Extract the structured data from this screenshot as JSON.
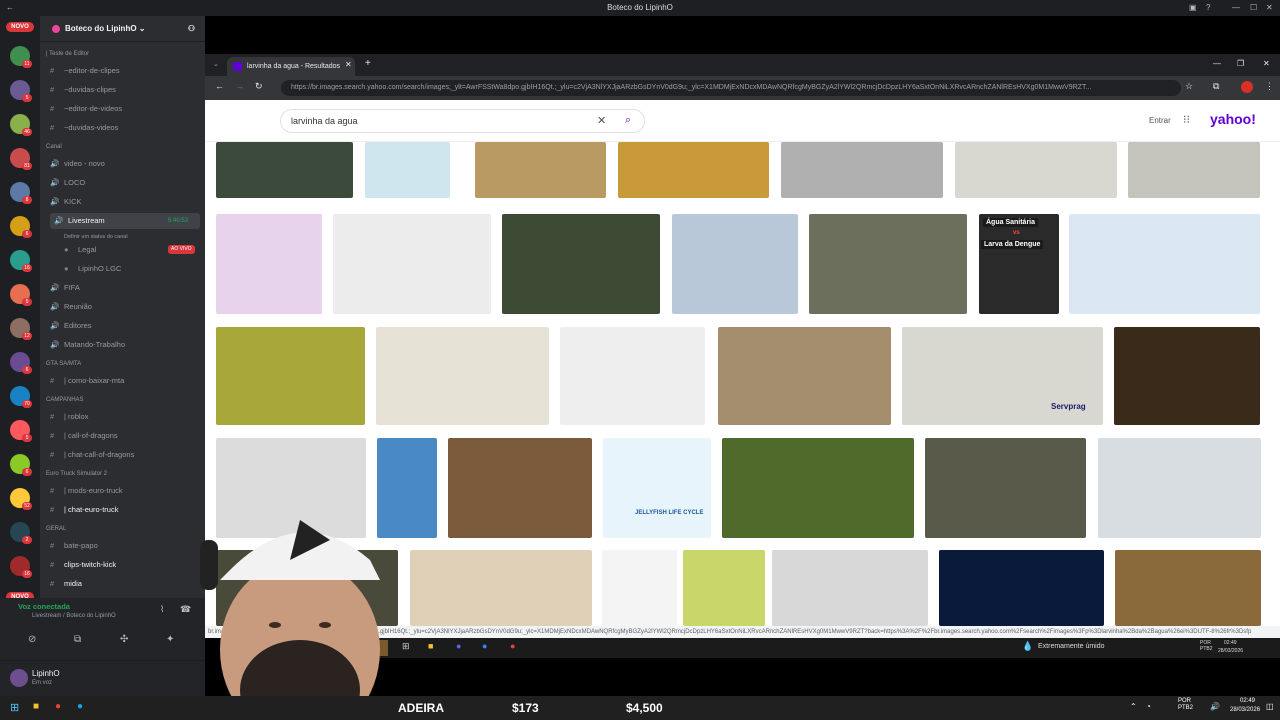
{
  "window": {
    "title": "Boteco do LipinhO"
  },
  "servers": {
    "novo_top": "NOVO",
    "novo_bottom": "NOVO",
    "badges": [
      "11",
      "5",
      "46",
      "81",
      "8",
      "6",
      "16",
      "5",
      "12",
      "6",
      "70",
      "5",
      "6",
      "52",
      "2",
      "16"
    ]
  },
  "guild": {
    "name": "Boteco do LipinhO"
  },
  "channels": [
    {
      "kind": "category",
      "label": "| Teste de Editor"
    },
    {
      "kind": "channel",
      "icon": "#",
      "label": "~editor-de-clipes"
    },
    {
      "kind": "channel",
      "icon": "#",
      "label": "~duvidas-clipes"
    },
    {
      "kind": "channel",
      "icon": "#",
      "label": "~editor-de-videos"
    },
    {
      "kind": "channel",
      "icon": "#",
      "label": "~duvidas-videos"
    },
    {
      "kind": "category",
      "label": "Canal"
    },
    {
      "kind": "voice",
      "label": "video - novo"
    },
    {
      "kind": "voice",
      "label": "LOCO"
    },
    {
      "kind": "voice",
      "label": "KICK"
    },
    {
      "kind": "voice",
      "label": "Livestream",
      "time": "5:40:53",
      "active": true
    },
    {
      "kind": "sub",
      "label": "Definir um status do canal"
    },
    {
      "kind": "member",
      "label": "Legal",
      "tag": "AO VIVO"
    },
    {
      "kind": "member",
      "label": "LipinhO LGC"
    },
    {
      "kind": "voice",
      "label": "FIFA"
    },
    {
      "kind": "voice",
      "label": "Reunião"
    },
    {
      "kind": "voice",
      "label": "Editores"
    },
    {
      "kind": "voice",
      "label": "Matando-Trabalho"
    },
    {
      "kind": "category",
      "label": "GTA SA/MTA"
    },
    {
      "kind": "channel",
      "icon": "#",
      "label": "| como-baixar-mta"
    },
    {
      "kind": "category",
      "label": "CAMPANHAS"
    },
    {
      "kind": "channel",
      "icon": "#",
      "label": "| roblox"
    },
    {
      "kind": "channel",
      "icon": "#",
      "label": "| call-of-dragons"
    },
    {
      "kind": "channel",
      "icon": "#",
      "label": "| chat-call-of-dragons"
    },
    {
      "kind": "category",
      "label": "Euro Truck Simulator 2"
    },
    {
      "kind": "channel",
      "icon": "#",
      "label": "| mods-euro-truck"
    },
    {
      "kind": "channel",
      "icon": "#",
      "label": "| chat-euro-truck",
      "bold": true
    },
    {
      "kind": "category",
      "label": "GERAL"
    },
    {
      "kind": "channel",
      "icon": "#",
      "label": "bate-papo"
    },
    {
      "kind": "channel",
      "icon": "#",
      "label": "clips-twitch-kick",
      "bold": true
    },
    {
      "kind": "channel",
      "icon": "#",
      "label": "midia",
      "bold": true
    }
  ],
  "voice": {
    "status": "Voz conectada",
    "where": "Livestream / Boteco do LipinhO"
  },
  "user": {
    "name": "LipinhO",
    "status": "Em voz"
  },
  "browser": {
    "tab_title": "larvinha da agua - Resultados",
    "url": "https://br.images.search.yahoo.com/search/images;_ylt=AwrFSStWa8dpo.gjbIH16Qt.;_ylu=c2VjA3NlYXJjaARzbGsDYnV0dG9u;_ylc=X1MDMjExNDcxMDAwNQRfcgMyBGZyA2lYWl2QRmcjDcDpzLHY6aSxtOnNiLXRvcARnchZANlREsHVXg0M1MwwV9RZT..."
  },
  "yahoo": {
    "query": "larvinha da agua",
    "signin": "Entrar",
    "logo": "yahoo!"
  },
  "image_labels": {
    "dengue_top": "Água Sanitária",
    "dengue_vs": "vs",
    "dengue_bottom": "Larva da Dengue",
    "servprag": "Servprag",
    "jellyfish": "JELLYFISH LIFE CYCLE"
  },
  "status_url": "br.images.search.yahoo.com/search/view;_ylt=AwrFSStWa8dpo.gjbIH16Qt.;_ylu=c2VjA3NlYXJjaARzbGsDYnV0dG9u;_ylc=X1MDMjExNDcxMDAwNQRfcgMyBGZyA2lYWl2QRmcjDcDpzLHY6aSxtOnNiLXRvcARnchZANlREsHVXg0M1MwwV9RZT?back=https%3A%2F%2Fbr.images.search.yahoo.com%2Fsearch%2Fimages%3Fp%3Dlarvinha%2Bda%2Bagua%26ei%3DUTF-8%26fr%3Dsfp",
  "inner_taskbar": {
    "weather": "Extremamente úmido",
    "lang": "POR PTB2",
    "time": "02:49",
    "date": "28/03/2026"
  },
  "stream_overlay": {
    "word": "ADEIRA",
    "price1": "$173",
    "price2": "$4,500"
  },
  "taskbar": {
    "lang": "POR PTB2",
    "time": "02:49",
    "date": "28/03/2026"
  }
}
